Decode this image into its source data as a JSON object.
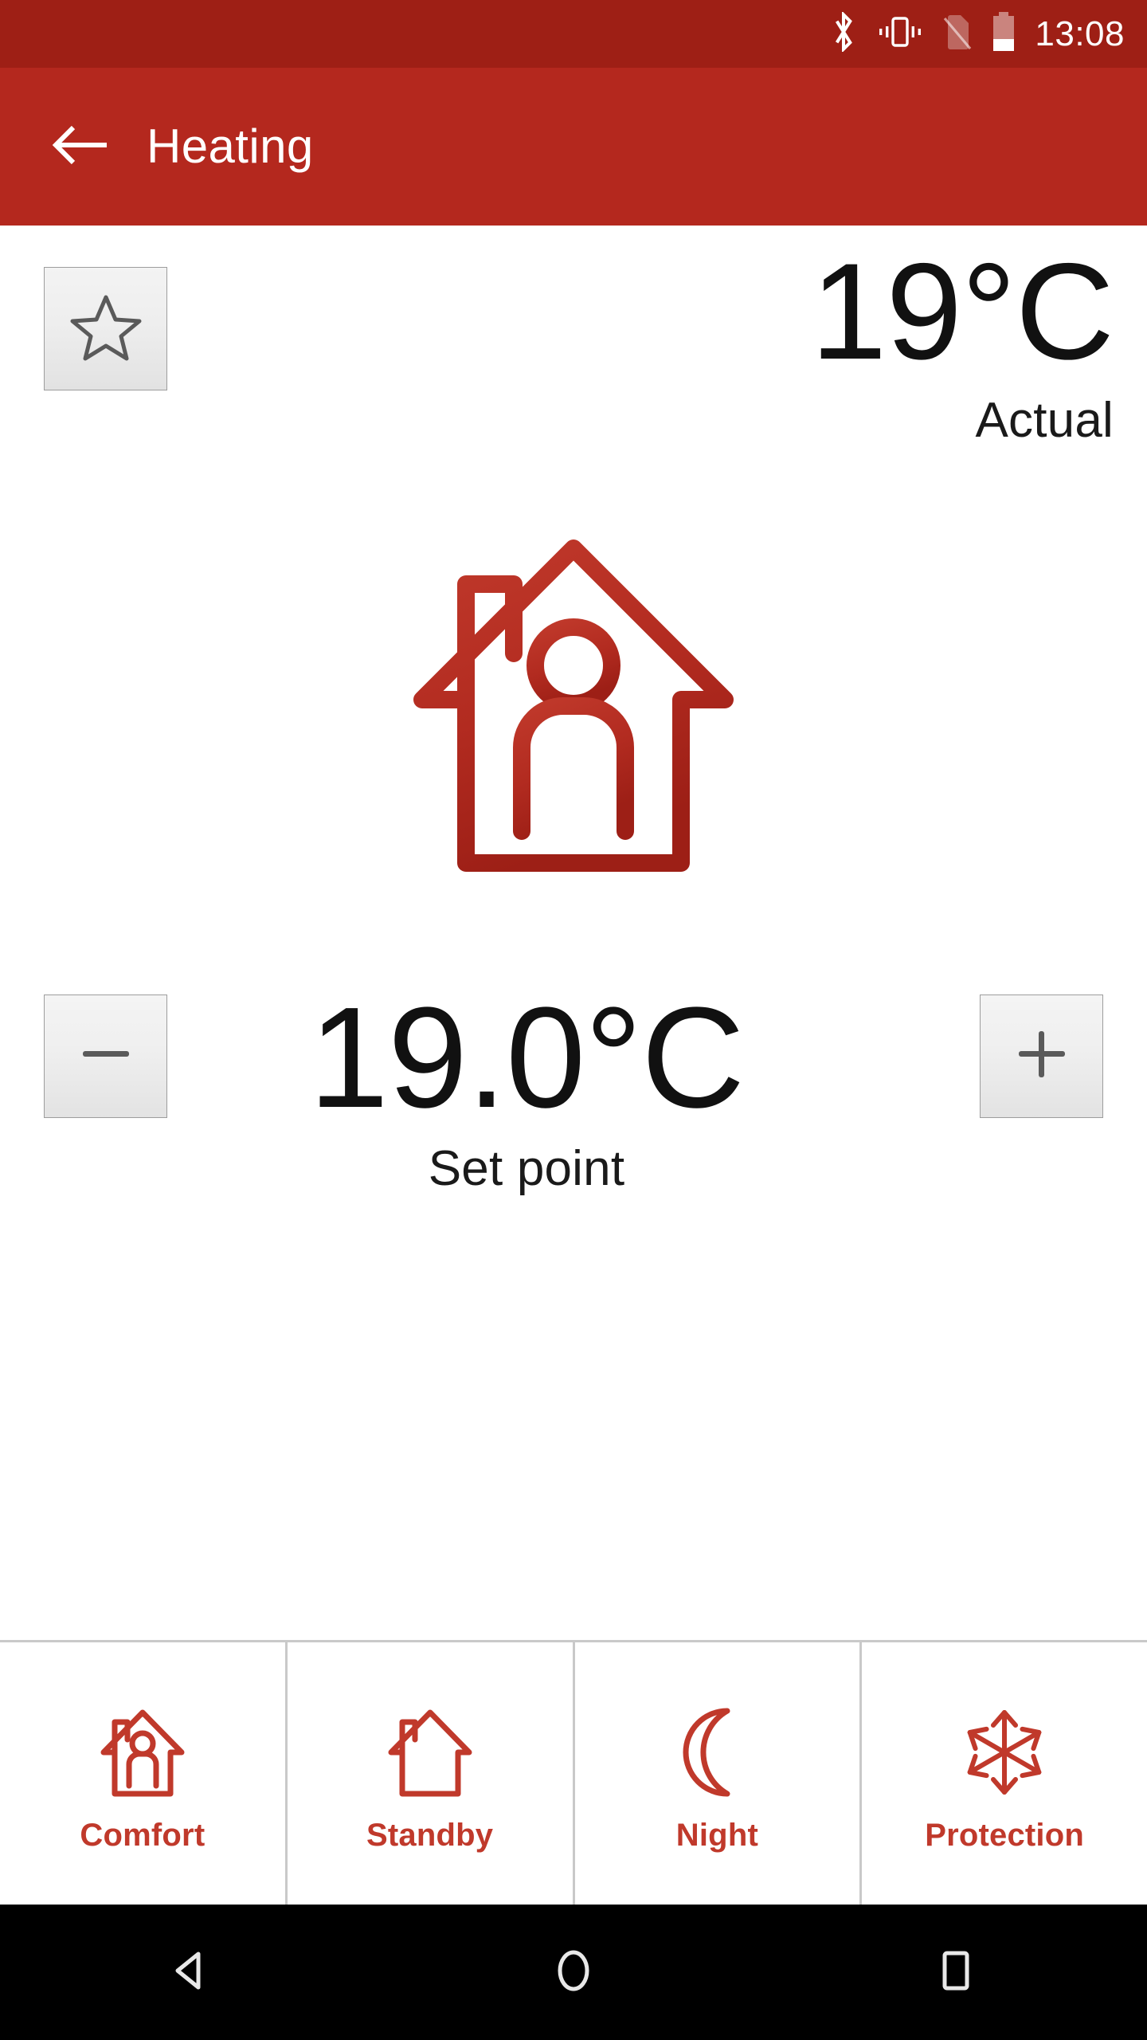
{
  "status_bar": {
    "time": "13:08",
    "icons": [
      {
        "name": "bluetooth-icon"
      },
      {
        "name": "vibrate-icon"
      },
      {
        "name": "no-sim-icon"
      },
      {
        "name": "battery-icon"
      }
    ],
    "background_color": "#9e1f15",
    "battery_level_percent": 35
  },
  "app_bar": {
    "title": "Heating",
    "back_icon": "arrow-left-icon",
    "background_color": "#b4281e",
    "text_color": "#ffffff"
  },
  "main": {
    "favorite": {
      "icon": "star-outline-icon",
      "active": false
    },
    "actual": {
      "value": "19°C",
      "label": "Actual"
    },
    "hero": {
      "icon": "house-with-person-icon",
      "color": "#b4281e"
    },
    "setpoint": {
      "value": "19.0°C",
      "label": "Set point",
      "decrease_label": "−",
      "increase_label": "+"
    }
  },
  "mode_bar": {
    "accent_color": "#c0392b",
    "items": [
      {
        "label": "Comfort",
        "icon": "house-with-person-icon"
      },
      {
        "label": "Standby",
        "icon": "house-empty-icon"
      },
      {
        "label": "Night",
        "icon": "crescent-moon-icon"
      },
      {
        "label": "Protection",
        "icon": "snowflake-icon"
      }
    ]
  },
  "nav_bar": {
    "buttons": [
      {
        "name": "android-back-button",
        "icon": "triangle-left-icon"
      },
      {
        "name": "android-home-button",
        "icon": "circle-icon"
      },
      {
        "name": "android-recents-button",
        "icon": "square-icon"
      }
    ]
  }
}
